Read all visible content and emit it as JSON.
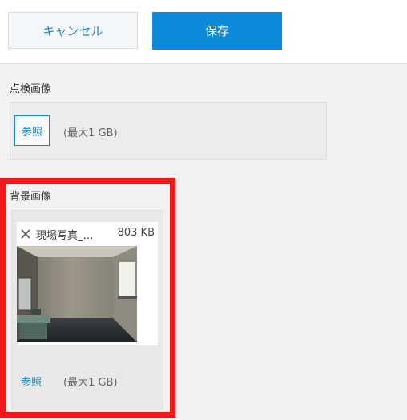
{
  "toolbar": {
    "cancel_label": "キャンセル",
    "save_label": "保存"
  },
  "inspection_image": {
    "label": "点検画像",
    "browse_label": "参照",
    "max_size_note": "(最大1 GB)"
  },
  "background_image": {
    "label": "背景画像",
    "file": {
      "name": "現場写真_…",
      "size": "803 KB"
    },
    "browse_label": "参照",
    "max_size_note": "(最大1 GB)"
  },
  "colors": {
    "accent": "#0a8ad8",
    "highlight": "#f01818"
  }
}
